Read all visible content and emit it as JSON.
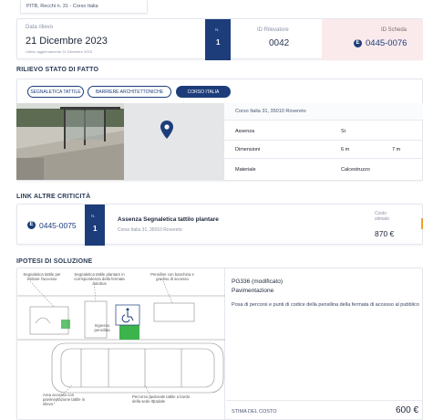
{
  "breadcrumb": "PITB, Recchi n. 31 - Corso Italia",
  "header": {
    "date_label": "Data rilievo",
    "date_value": "21 Dicembre 2023",
    "date_sub": "Ultimo aggiornamento 21 Dicembre 2023",
    "counter_label": "N.",
    "counter_value": "1",
    "survey_label": "ID Rilevatore",
    "survey_value": "0042",
    "sheet_label": "ID Scheda",
    "sheet_value": "0445-0076"
  },
  "section_state": "RILIEVO STATO DI FATTO",
  "chips": [
    {
      "label": "SEGNALETICA TATTILE"
    },
    {
      "label": "BARRIERE ARCHITETTONICHE"
    },
    {
      "label": "CORSO ITALIA"
    }
  ],
  "location": {
    "address": "Corso Italia 31, 35010 Rovereto",
    "rows": [
      {
        "label": "Assenza",
        "value": "Si",
        "extra": ""
      },
      {
        "label": "Dimensioni",
        "value": "6 m",
        "extra": "7 m"
      },
      {
        "label": "Materiale",
        "value": "Calcestruzzo",
        "extra": ""
      }
    ]
  },
  "section_link": "LINK ALTRE CRITICITÀ",
  "link_card": {
    "id": "0445-0075",
    "counter_label": "N.",
    "counter_value": "1",
    "title": "Assenza Segnaletica tattilo plantare",
    "subtitle": "Corso Italia 31, 35010 Rovereto",
    "cost_label": "Costo stimato",
    "cost_value": "870 €"
  },
  "section_solution": "IPOTESI DI SOLUZIONE",
  "plan_labels": [
    "Segnaletica tattile per limitare l'accesso",
    "Segnaletica tattile plantare in corrispondenza della fermata autobus",
    "Pensiline con banchina e gradino di accesso",
    "Ingresso pensilina",
    "Area accesso con pavimentazione tattile in rilievo",
    "Percorso pedonale tattile a bordo della sede stradale"
  ],
  "solution": {
    "code": "PG336 (modificato)",
    "title": "Pavimentazione",
    "description": "Posa di percorsi e punti di codice della pensilina della fermata di accesso al pubblico",
    "cost_label": "STIMA DEL COSTO",
    "cost_value": "600 €"
  },
  "icons": {
    "map_pin": "map-pin-icon",
    "id_badge": "id-badge-icon",
    "accessibility": "wheelchair-icon"
  },
  "colors": {
    "accent": "#1c3d7a",
    "sheet_bg": "#fbeaec",
    "highlight_green": "#3cb44b",
    "highlight_orange": "#f0a030"
  }
}
